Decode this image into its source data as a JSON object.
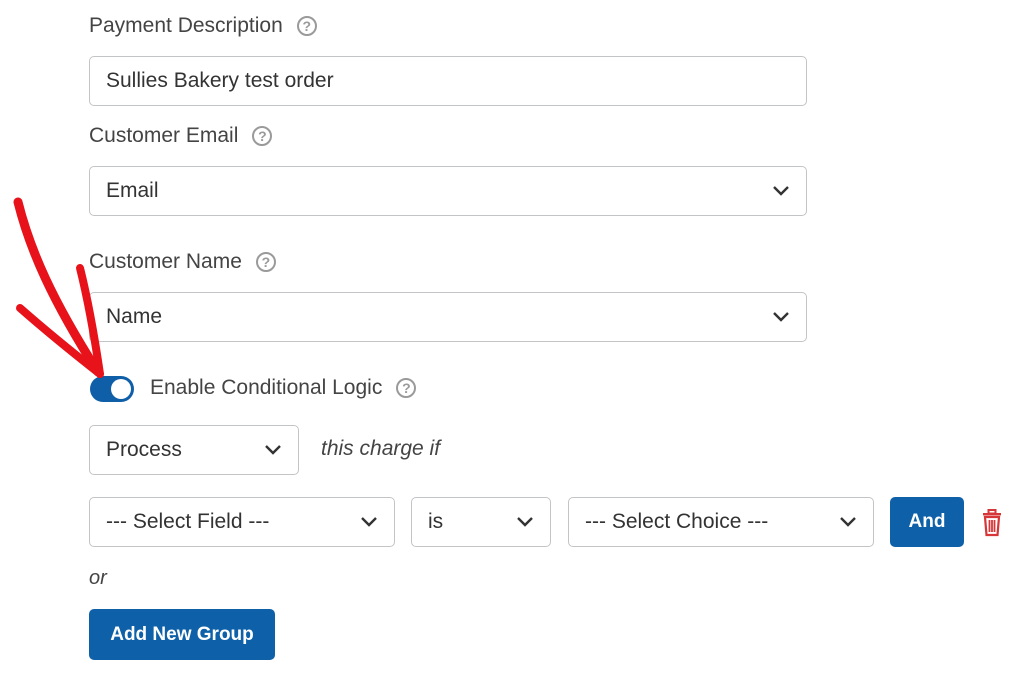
{
  "payment_description": {
    "label": "Payment Description",
    "value": "Sullies Bakery test order"
  },
  "customer_email": {
    "label": "Customer Email",
    "selected": "Email"
  },
  "customer_name": {
    "label": "Customer Name",
    "selected": "Name"
  },
  "conditional_logic": {
    "label": "Enable Conditional Logic",
    "enabled": true,
    "action_selected": "Process",
    "connector_text": "this charge if",
    "rule": {
      "field_selected": "--- Select Field ---",
      "operator_selected": "is",
      "choice_selected": "--- Select Choice ---",
      "and_label": "And"
    },
    "or_text": "or",
    "add_group_label": "Add New Group"
  },
  "help_icon_glyph": "?",
  "colors": {
    "primary": "#0e61a9",
    "annotation_arrow": "#e8121a",
    "delete": "#d63638"
  }
}
